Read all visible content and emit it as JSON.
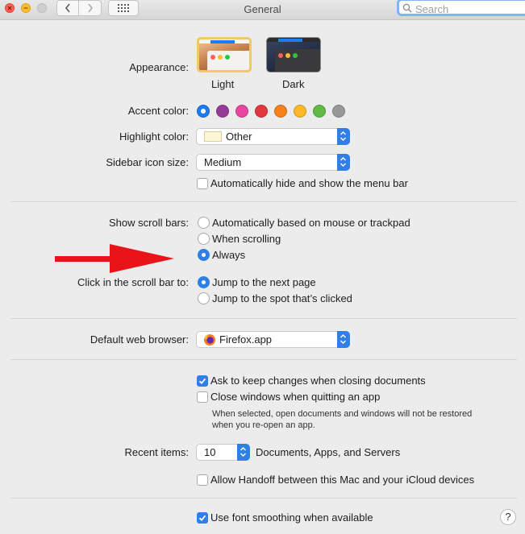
{
  "window": {
    "title": "General"
  },
  "search": {
    "placeholder": "Search"
  },
  "appearance": {
    "label": "Appearance:",
    "options": [
      "Light",
      "Dark"
    ],
    "selected": "Light"
  },
  "accent": {
    "label": "Accent color:",
    "colors": [
      "#1d7cf2",
      "#953d96",
      "#e8469f",
      "#e0383e",
      "#f7821b",
      "#fcb827",
      "#62ba46",
      "#989898"
    ],
    "selected_index": 0
  },
  "highlight": {
    "label": "Highlight color:",
    "value": "Other",
    "swatch_color": "#fdf6d7"
  },
  "sidebar_icon": {
    "label": "Sidebar icon size:",
    "value": "Medium"
  },
  "menubar": {
    "label": "Automatically hide and show the menu bar",
    "checked": false
  },
  "scrollbars": {
    "label": "Show scroll bars:",
    "options": [
      "Automatically based on mouse or trackpad",
      "When scrolling",
      "Always"
    ],
    "selected_index": 2
  },
  "click_scroll": {
    "label": "Click in the scroll bar to:",
    "options": [
      "Jump to the next page",
      "Jump to the spot that’s clicked"
    ],
    "selected_index": 0
  },
  "browser": {
    "label": "Default web browser:",
    "value": "Firefox.app"
  },
  "ask_keep": {
    "label": "Ask to keep changes when closing documents",
    "checked": true
  },
  "close_windows": {
    "label": "Close windows when quitting an app",
    "checked": false,
    "note_line1": "When selected, open documents and windows will not be restored",
    "note_line2": "when you re-open an app."
  },
  "recent": {
    "label": "Recent items:",
    "value": "10",
    "suffix": "Documents, Apps, and Servers"
  },
  "handoff": {
    "label": "Allow Handoff between this Mac and your iCloud devices",
    "checked": false
  },
  "font_smoothing": {
    "label": "Use font smoothing when available",
    "checked": true
  },
  "help": {
    "label": "?"
  },
  "annotation": {
    "arrow_color": "#e8141a"
  },
  "colors": {
    "accent_blue": "#2f7fe8",
    "window_bg": "#ececec"
  }
}
